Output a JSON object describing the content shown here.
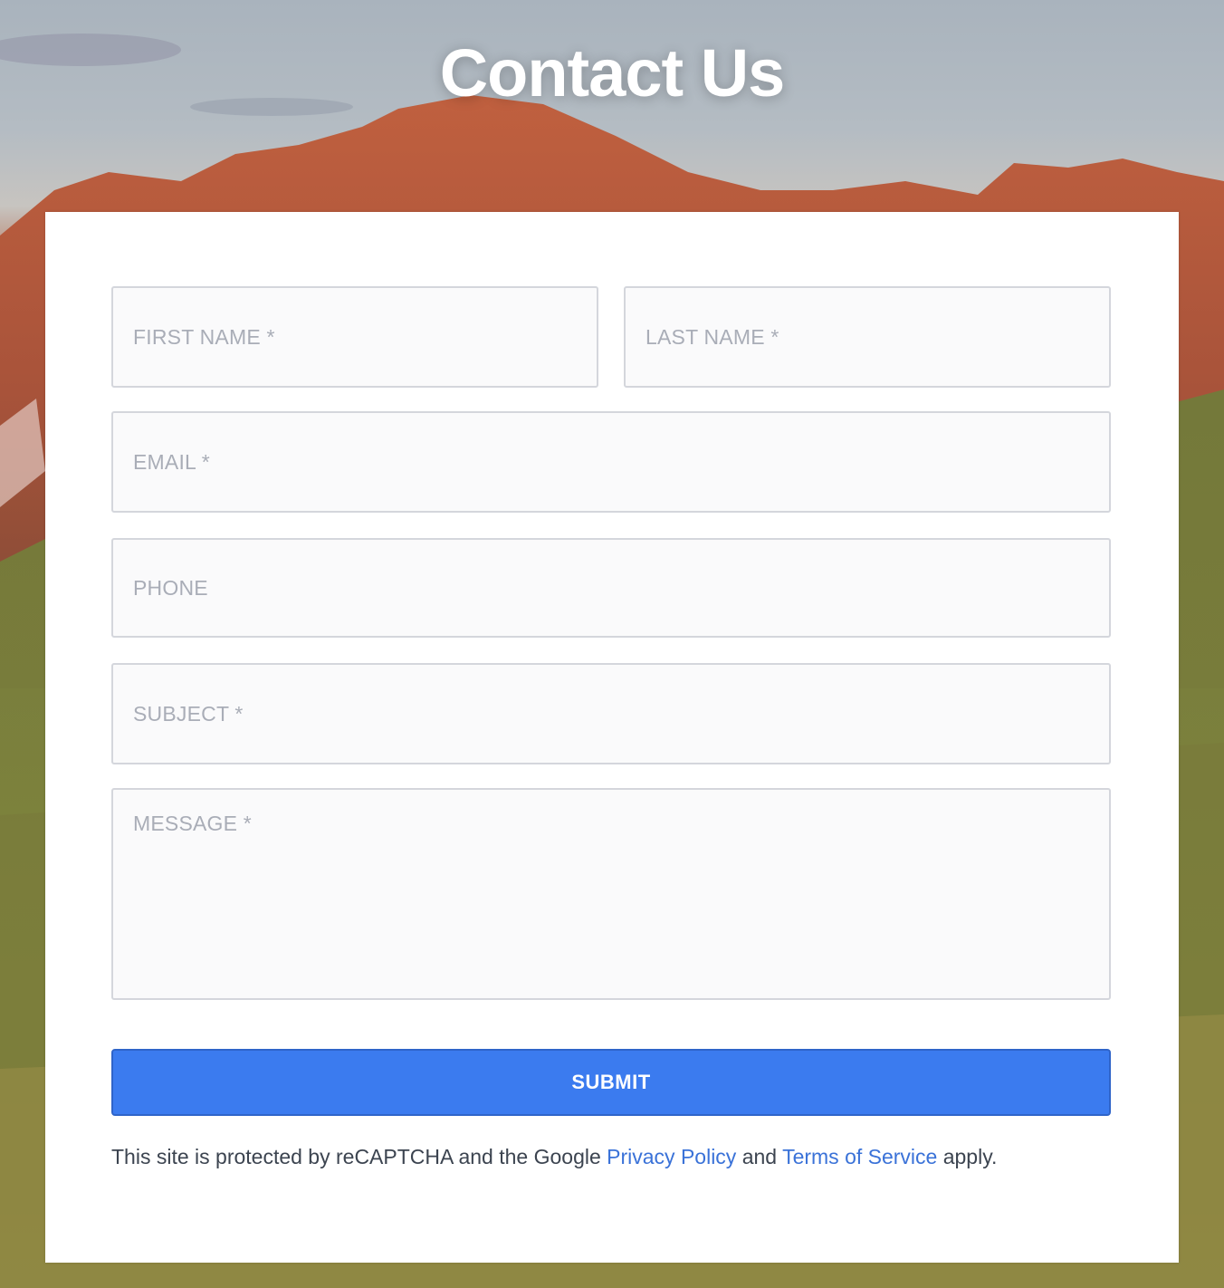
{
  "header": {
    "title": "Contact Us"
  },
  "form": {
    "first_name_placeholder": "FIRST NAME *",
    "last_name_placeholder": "LAST NAME *",
    "email_placeholder": "EMAIL *",
    "phone_placeholder": "PHONE",
    "subject_placeholder": "SUBJECT *",
    "message_placeholder": "MESSAGE *",
    "submit_label": "SUBMIT"
  },
  "recaptcha": {
    "prefix": "This site is protected by reCAPTCHA and the Google ",
    "privacy_link": "Privacy Policy",
    "middle": " and ",
    "terms_link": "Terms of Service",
    "suffix": " apply."
  },
  "colors": {
    "accent": "#3b7bef",
    "link": "#3a72d8",
    "placeholder": "#a9adb7",
    "field_border": "#d4d6dc"
  }
}
